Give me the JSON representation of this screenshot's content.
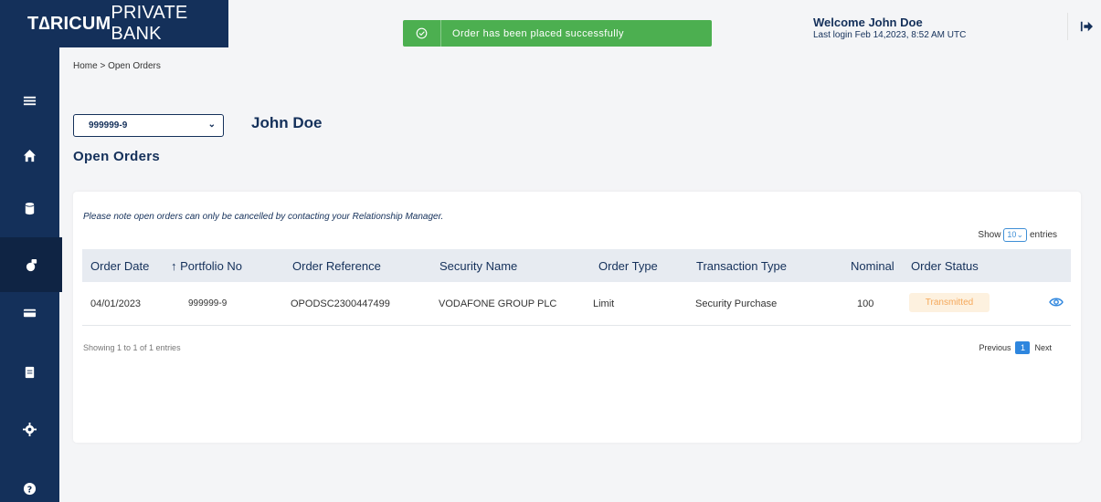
{
  "brand": {
    "name_bold": "T∆RICUM",
    "name_rest": " PRIVATE BANK"
  },
  "header": {
    "welcome": "Welcome John Doe",
    "last_login": "Last login Feb 14,2023, 8:52 AM UTC"
  },
  "toast": {
    "message": "Order has been placed successfully",
    "color": "#4caf50"
  },
  "sidebar": {
    "items": [
      {
        "icon": "menu-icon"
      },
      {
        "icon": "home-icon"
      },
      {
        "icon": "database-icon"
      },
      {
        "icon": "orders-icon",
        "active": true
      },
      {
        "icon": "card-icon"
      },
      {
        "icon": "clipboard-icon"
      },
      {
        "icon": "settings-icon"
      },
      {
        "icon": "help-icon"
      }
    ]
  },
  "breadcrumb": "Home > Open Orders",
  "account": {
    "selected": "999999-9",
    "client_name": "John Doe"
  },
  "page_title": "Open Orders",
  "notice": "Please note open orders can only be cancelled by contacting your Relationship Manager.",
  "table_controls": {
    "show_label": "Show",
    "page_length": "10",
    "entries_label": "entries"
  },
  "table": {
    "headers": [
      "Order Date",
      "↑ Portfolio No",
      "Order Reference",
      "Security Name",
      "Order Type",
      "Transaction Type",
      "Nominal",
      "Order Status"
    ],
    "rows": [
      {
        "order_date": "04/01/2023",
        "portfolio_no": "999999-9",
        "order_reference": "OPODSC2300447499",
        "security_name": "VODAFONE GROUP PLC",
        "order_type": "Limit",
        "transaction_type": "Security Purchase",
        "nominal": "100",
        "order_status": "Transmitted"
      }
    ]
  },
  "footer": {
    "info": "Showing 1 to 1 of 1 entries",
    "previous": "Previous",
    "current_page": "1",
    "next": "Next"
  },
  "colors": {
    "navy": "#14305a",
    "status_bg": "#fdf1df",
    "status_text": "#f5a85a",
    "accent": "#2e86de"
  }
}
